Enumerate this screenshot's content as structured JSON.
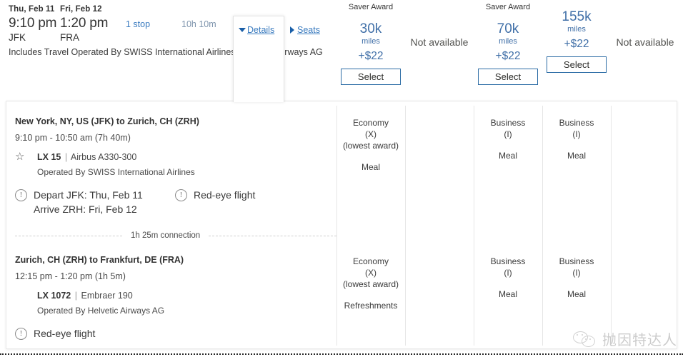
{
  "summary": {
    "depart": {
      "date": "Thu, Feb 11",
      "time": "9:10 pm",
      "code": "JFK"
    },
    "arrive": {
      "date": "Fri, Feb 12",
      "time": "1:20 pm",
      "code": "FRA"
    },
    "stops": "1 stop",
    "duration": "10h 10m",
    "includes": "Includes Travel Operated By SWISS International Airlines , Helvetic Airways AG",
    "details_label": "Details",
    "seats_label": "Seats"
  },
  "fare_columns": [
    {
      "header": "Saver Award",
      "miles": "30k",
      "miles_word": "miles",
      "tax": "+$22",
      "select_label": "Select",
      "available": true
    },
    {
      "header": "",
      "unavailable_label": "Not available",
      "available": false
    },
    {
      "header": "Saver Award",
      "miles": "70k",
      "miles_word": "miles",
      "tax": "+$22",
      "select_label": "Select",
      "available": true
    },
    {
      "header": "",
      "miles": "155k",
      "miles_word": "miles",
      "tax": "+$22",
      "select_label": "Select",
      "available": true
    },
    {
      "header": "",
      "unavailable_label": "Not available",
      "available": false
    }
  ],
  "details": {
    "connection": "1h 25m connection",
    "segments": [
      {
        "route": "New York, NY, US (JFK) to Zurich, CH (ZRH)",
        "times": "9:10 pm - 10:50 am (7h 40m)",
        "flight_number": "LX 15",
        "separator": "|",
        "equipment": "Airbus A330-300",
        "operated_by": "Operated By SWISS International Airlines",
        "note_a_line1": "Depart JFK: Thu, Feb 11",
        "note_a_line2": "Arrive ZRH: Fri, Feb 12",
        "note_b": "Red-eye flight",
        "cabins": [
          {
            "cls": "Economy",
            "book": "(X)",
            "lowest": "(lowest award)",
            "svc": "Meal"
          },
          {
            "cls": "",
            "book": "",
            "lowest": "",
            "svc": ""
          },
          {
            "cls": "Business",
            "book": "(I)",
            "lowest": "",
            "svc": "Meal"
          },
          {
            "cls": "Business",
            "book": "(I)",
            "lowest": "",
            "svc": "Meal"
          },
          {
            "cls": "",
            "book": "",
            "lowest": "",
            "svc": ""
          }
        ]
      },
      {
        "route": "Zurich, CH (ZRH) to Frankfurt, DE (FRA)",
        "times": "12:15 pm - 1:20 pm (1h 5m)",
        "flight_number": "LX 1072",
        "separator": "|",
        "equipment": "Embraer 190",
        "operated_by": "Operated By Helvetic Airways AG",
        "note_a_line1": "Red-eye flight",
        "note_a_line2": "",
        "note_b": "",
        "cabins": [
          {
            "cls": "Economy",
            "book": "(X)",
            "lowest": "(lowest award)",
            "svc": "Refreshments"
          },
          {
            "cls": "",
            "book": "",
            "lowest": "",
            "svc": ""
          },
          {
            "cls": "Business",
            "book": "(I)",
            "lowest": "",
            "svc": "Meal"
          },
          {
            "cls": "Business",
            "book": "(I)",
            "lowest": "",
            "svc": "Meal"
          },
          {
            "cls": "",
            "book": "",
            "lowest": "",
            "svc": ""
          }
        ]
      }
    ]
  },
  "watermark": {
    "text": "抛因特达人"
  },
  "colors": {
    "link": "#3a7bbf",
    "miles": "#4170a8",
    "button_border": "#2c6ca5",
    "text": "#333333"
  }
}
